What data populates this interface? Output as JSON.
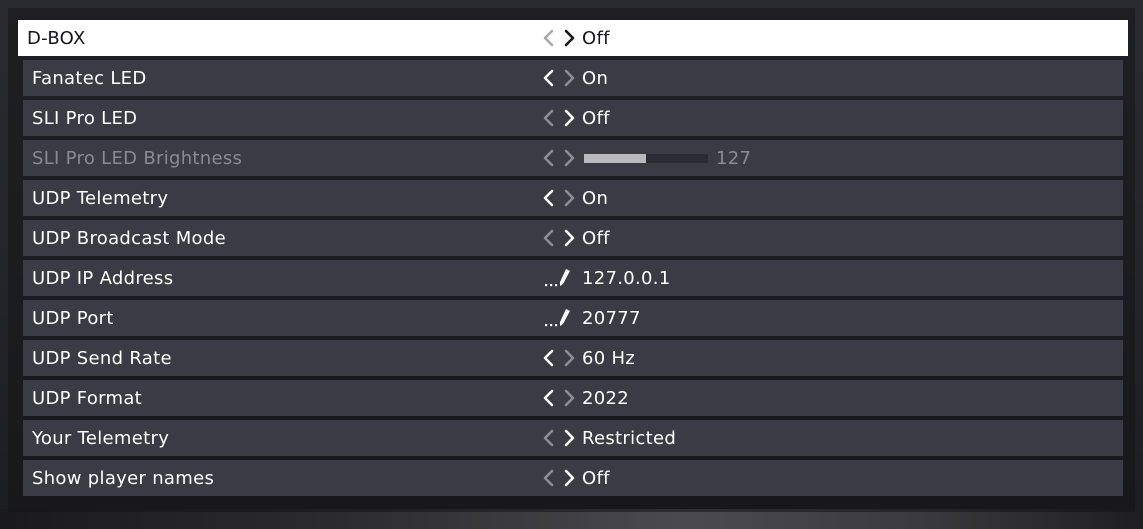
{
  "settings": {
    "rows": [
      {
        "label": "D-BOX",
        "value": "Off",
        "control": "arrows",
        "left_enabled": false,
        "right_enabled": true,
        "state": "selected"
      },
      {
        "label": "Fanatec LED",
        "value": "On",
        "control": "arrows",
        "left_enabled": true,
        "right_enabled": false,
        "state": "normal"
      },
      {
        "label": "SLI Pro LED",
        "value": "Off",
        "control": "arrows",
        "left_enabled": false,
        "right_enabled": true,
        "state": "normal"
      },
      {
        "label": "SLI Pro LED Brightness",
        "value": "127",
        "control": "slider",
        "slider_fraction": 0.5,
        "left_enabled": false,
        "right_enabled": false,
        "state": "disabled"
      },
      {
        "label": "UDP Telemetry",
        "value": "On",
        "control": "arrows",
        "left_enabled": true,
        "right_enabled": false,
        "state": "normal"
      },
      {
        "label": "UDP Broadcast Mode",
        "value": "Off",
        "control": "arrows",
        "left_enabled": false,
        "right_enabled": true,
        "state": "normal"
      },
      {
        "label": "UDP IP Address",
        "value": "127.0.0.1",
        "control": "edit",
        "state": "normal"
      },
      {
        "label": "UDP Port",
        "value": "20777",
        "control": "edit",
        "state": "normal"
      },
      {
        "label": "UDP Send Rate",
        "value": "60 Hz",
        "control": "arrows",
        "left_enabled": true,
        "right_enabled": false,
        "state": "normal"
      },
      {
        "label": "UDP Format",
        "value": "2022",
        "control": "arrows",
        "left_enabled": true,
        "right_enabled": false,
        "state": "normal"
      },
      {
        "label": "Your Telemetry",
        "value": "Restricted",
        "control": "arrows",
        "left_enabled": false,
        "right_enabled": true,
        "state": "normal"
      },
      {
        "label": "Show player names",
        "value": "Off",
        "control": "arrows",
        "left_enabled": false,
        "right_enabled": true,
        "state": "normal"
      }
    ]
  },
  "icons": {
    "arrow_left": "chevron-left-icon",
    "arrow_right": "chevron-right-icon",
    "edit": "pencil-edit-icon"
  },
  "colors": {
    "row_bg": "#3a3b44",
    "selected_bg": "#ffffff",
    "text": "#ffffff",
    "selected_text": "#15151a",
    "disabled_text": "#8a8b92",
    "arrow_enabled": "#ffffff",
    "arrow_disabled": "#8d8e95",
    "slider_fill": "#b9b9bd",
    "slider_track": "#2b2c33"
  }
}
